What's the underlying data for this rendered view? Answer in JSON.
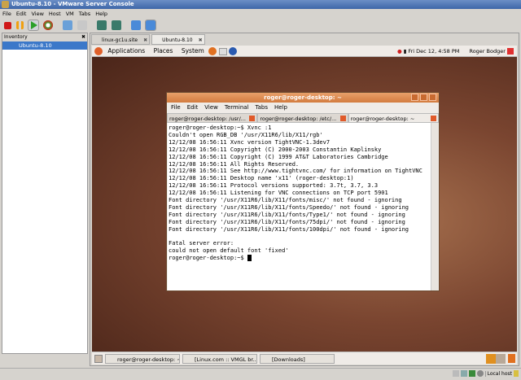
{
  "window": {
    "title": "Ubuntu-8.10 - VMware Server Console"
  },
  "menu": [
    "File",
    "Edit",
    "View",
    "Host",
    "VM",
    "Tabs",
    "Help"
  ],
  "toolbar": [
    "stop-icon",
    "pause-icon",
    "play-icon",
    "reset-icon",
    "snapshot-icon",
    "revert-icon",
    "fullscreen-icon",
    "quick-switch-icon",
    "summary-icon",
    "console-icon"
  ],
  "inventory": {
    "title": "Inventory",
    "items": [
      "Ubuntu-8.10"
    ]
  },
  "console_tabs": [
    {
      "label": "linux-gc1u.site"
    },
    {
      "label": "Ubuntu-8.10",
      "active": true
    }
  ],
  "gnome_panel": {
    "menus": [
      "Applications",
      "Places",
      "System"
    ],
    "clock": "Fri Dec 12,  4:58 PM",
    "user": "Roger Bodger"
  },
  "terminal": {
    "title": "roger@roger-desktop: ~",
    "menu": [
      "File",
      "Edit",
      "View",
      "Terminal",
      "Tabs",
      "Help"
    ],
    "tabs": [
      "roger@roger-desktop: /usr/...",
      "roger@roger-desktop: /etc/...",
      "roger@roger-desktop: ~"
    ],
    "lines": [
      "roger@roger-desktop:~$ Xvnc :1",
      "Couldn't open RGB_DB '/usr/X11R6/lib/X11/rgb'",
      "12/12/08 16:56:11 Xvnc version TightVNC-1.3dev7",
      "12/12/08 16:56:11 Copyright (C) 2000-2003 Constantin Kaplinsky",
      "12/12/08 16:56:11 Copyright (C) 1999 AT&T Laboratories Cambridge",
      "12/12/08 16:56:11 All Rights Reserved.",
      "12/12/08 16:56:11 See http://www.tightvnc.com/ for information on TightVNC",
      "12/12/08 16:56:11 Desktop name 'x11' (roger-desktop:1)",
      "12/12/08 16:56:11 Protocol versions supported: 3.7t, 3.7, 3.3",
      "12/12/08 16:56:11 Listening for VNC connections on TCP port 5901",
      "Font directory '/usr/X11R6/lib/X11/fonts/misc/' not found - ignoring",
      "Font directory '/usr/X11R6/lib/X11/fonts/Speedo/' not found - ignoring",
      "Font directory '/usr/X11R6/lib/X11/fonts/Type1/' not found - ignoring",
      "Font directory '/usr/X11R6/lib/X11/fonts/75dpi/' not found - ignoring",
      "Font directory '/usr/X11R6/lib/X11/fonts/100dpi/' not found - ignoring",
      "",
      "Fatal server error:",
      "could not open default font 'fixed'"
    ],
    "prompt": "roger@roger-desktop:~$ "
  },
  "taskbar": [
    "roger@roger-desktop: ~",
    "[Linux.com :: VMGL br...",
    "[Downloads]"
  ],
  "status": {
    "host": "Local host"
  }
}
